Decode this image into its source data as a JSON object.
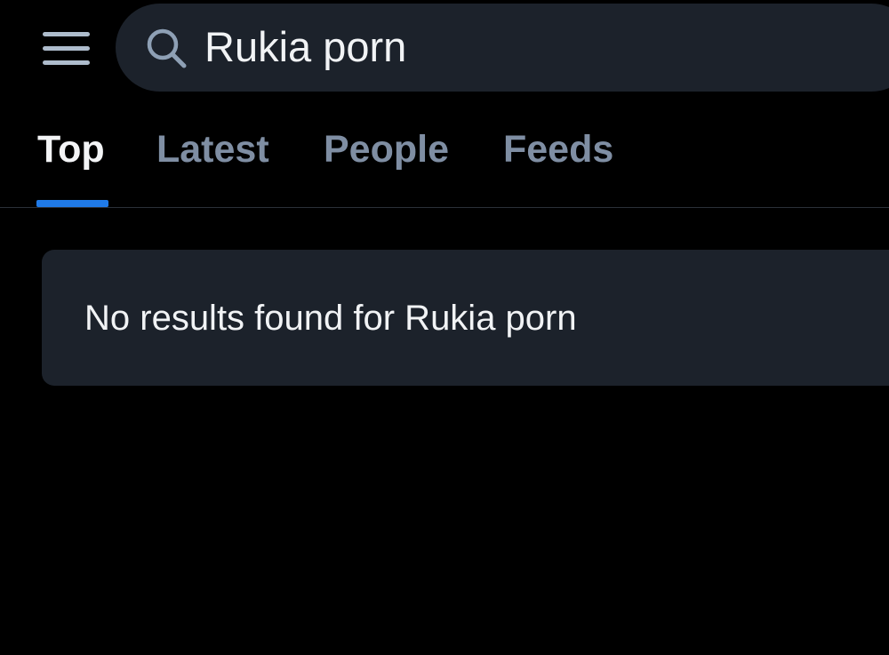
{
  "header": {
    "menu_icon": "hamburger-menu-icon",
    "search": {
      "icon": "search-icon",
      "value": "Rukia porn"
    }
  },
  "tabs": [
    {
      "label": "Top",
      "active": true
    },
    {
      "label": "Latest",
      "active": false
    },
    {
      "label": "People",
      "active": false
    },
    {
      "label": "Feeds",
      "active": false
    }
  ],
  "results": {
    "empty_message": "No results found for Rukia porn"
  },
  "colors": {
    "background": "#000000",
    "surface": "#1c222b",
    "accent": "#1f7ae8",
    "tab_inactive": "#7f8ea3",
    "text_primary": "#f1f3f5"
  }
}
